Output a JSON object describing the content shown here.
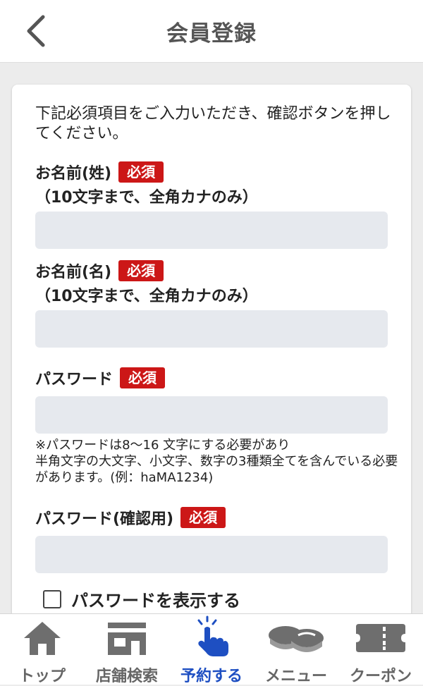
{
  "header": {
    "title": "会員登録",
    "back_icon": "chevron-left-icon"
  },
  "form": {
    "intro": "下記必須項目をご入力いただき、確認ボタンを押してください。",
    "required_badge": "必須",
    "last_name": {
      "label": "お名前(姓)",
      "hint": "（10文字まで、全角カナのみ）",
      "value": "",
      "placeholder": ""
    },
    "first_name": {
      "label": "お名前(名)",
      "hint": "（10文字まで、全角カナのみ）",
      "value": "",
      "placeholder": ""
    },
    "password": {
      "label": "パスワード",
      "value": "",
      "placeholder": "",
      "note_line1": "※パスワードは8～16 文字にする必要があり",
      "note_line2": "半角文字の大文字、小文字、数字の3種類全てを含んでいる必要があります。(例：haMA1234)"
    },
    "password_confirm": {
      "label": "パスワード(確認用)",
      "value": "",
      "placeholder": ""
    },
    "show_password": {
      "label": "パスワードを表示する",
      "checked": false
    }
  },
  "tabbar": {
    "tabs": [
      {
        "id": "top",
        "label": "トップ",
        "icon": "house-icon",
        "active": false
      },
      {
        "id": "store",
        "label": "店舗検索",
        "icon": "store-icon",
        "active": false
      },
      {
        "id": "reserve",
        "label": "予約する",
        "icon": "tap-hand-icon",
        "active": true
      },
      {
        "id": "menu",
        "label": "メニュー",
        "icon": "sushi-icon",
        "active": false
      },
      {
        "id": "coupon",
        "label": "クーポン",
        "icon": "ticket-icon",
        "active": false
      }
    ],
    "colors": {
      "active": "#1e4fc2",
      "inactive": "#666666",
      "icon_inactive": "#6e6e6e"
    }
  },
  "colors": {
    "required_badge": "#cc1717",
    "field_bg": "#e6e9ee",
    "page_bg": "#ececec"
  }
}
